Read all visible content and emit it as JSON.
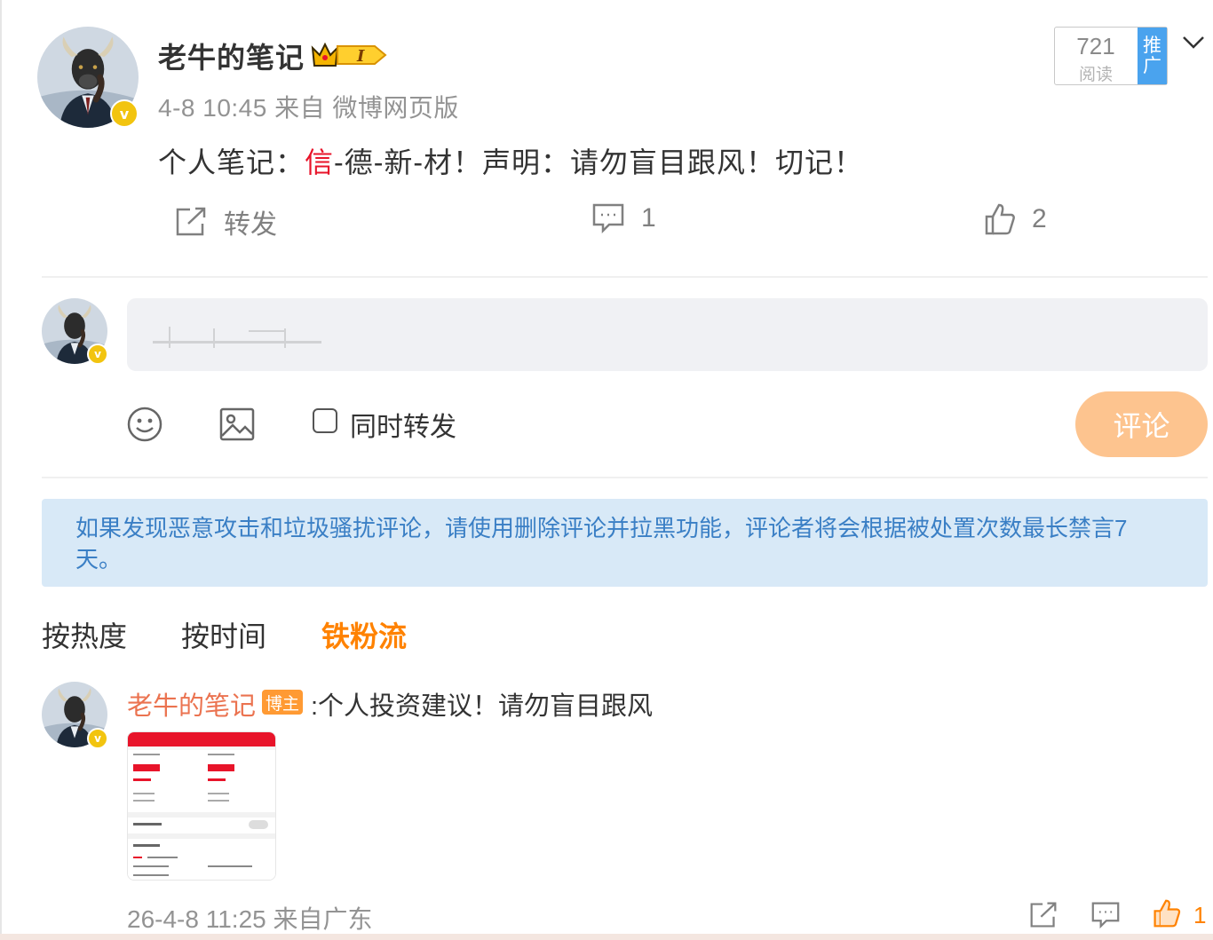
{
  "post": {
    "author": "老牛的笔记",
    "time": "4-8 10:45",
    "source": "来自 微博网页版",
    "text_prefix": "个人笔记：",
    "text_highlight": "信",
    "text_rest": "-德-新-材！声明：请勿盲目跟风！切记！",
    "read_count": "721",
    "read_label": "阅读",
    "promote_label": "推广",
    "actions": {
      "repost_label": "转发",
      "comment_count": "1",
      "like_count": "2"
    }
  },
  "composer": {
    "also_repost_label": "同时转发",
    "submit_label": "评论"
  },
  "notice": "如果发现恶意攻击和垃圾骚扰评论，请使用删除评论并拉黑功能，评论者将会根据被处置次数最长禁言7天。",
  "sort_tabs": [
    {
      "label": "按热度",
      "active": false
    },
    {
      "label": "按时间",
      "active": false
    },
    {
      "label": "铁粉流",
      "active": true
    }
  ],
  "comments": [
    {
      "author": "老牛的笔记",
      "badge": "博主",
      "text": ":个人投资建议！请勿盲目跟风",
      "time": "26-4-8 11:25",
      "source": "来自广东",
      "like_count": "1"
    }
  ],
  "colors": {
    "accent_orange": "#ff8200",
    "highlight_red": "#e8142a",
    "notice_bg": "#d8e9f7",
    "promote_blue": "#4aa3ee"
  }
}
